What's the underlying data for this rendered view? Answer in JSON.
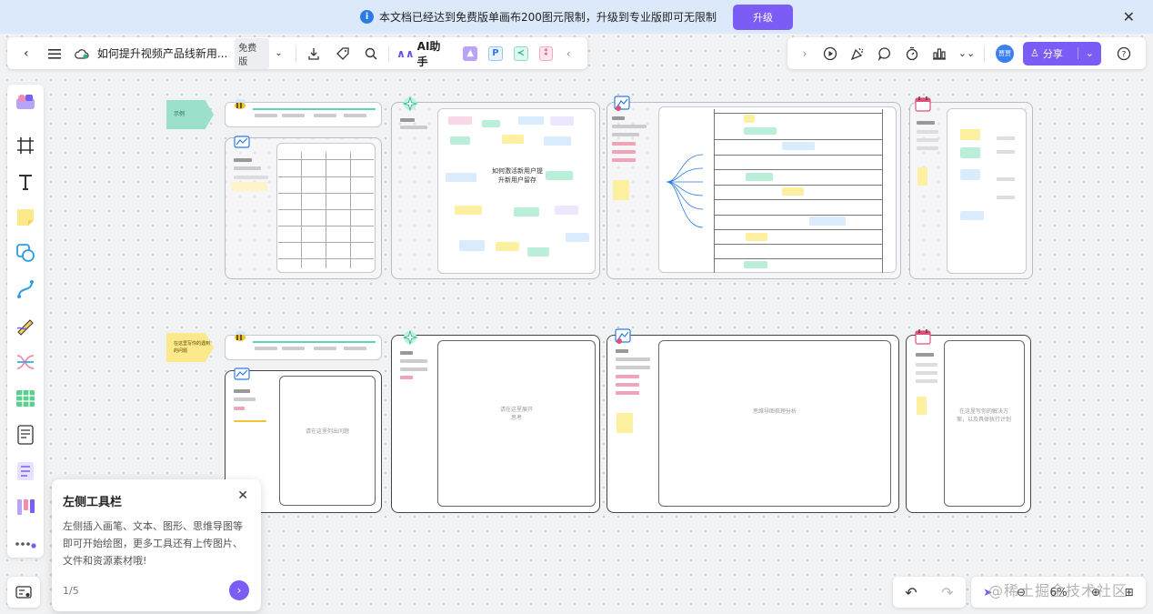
{
  "banner": {
    "info_icon": "info-icon",
    "message": "本文档已经达到免费版单画布200图元限制，升级到专业版即可无限制",
    "upgrade_label": "升级",
    "close_icon": "close-icon"
  },
  "toolbar": {
    "doc_title": "如何提升视频产品线新用...",
    "plan_tag": "免费版",
    "ai_label": "AI助手",
    "share_label": "分享",
    "avatar_text": "贾贾"
  },
  "guide": {
    "title": "左侧工具栏",
    "body": "左侧插入画笔、文本、图形、思维导图等即可开始绘图，更多工具还有上传图片、文件和资源素材哦!",
    "page": "1/5"
  },
  "canvas": {
    "row1_tag": "示例",
    "row2_tag": "在这里写你的遇到的问题",
    "center_topic": "如何激活新用户提升新用户留存",
    "placeholder_1": "请在这里列出问题",
    "placeholder_2": "请在这里展开思考",
    "placeholder_3": "思维导图梳理分析",
    "placeholder_4": "在这里写你的解决方案，以及具体执行计划"
  },
  "watermark": "@稀土掘金技术社区",
  "zoom": "6%"
}
